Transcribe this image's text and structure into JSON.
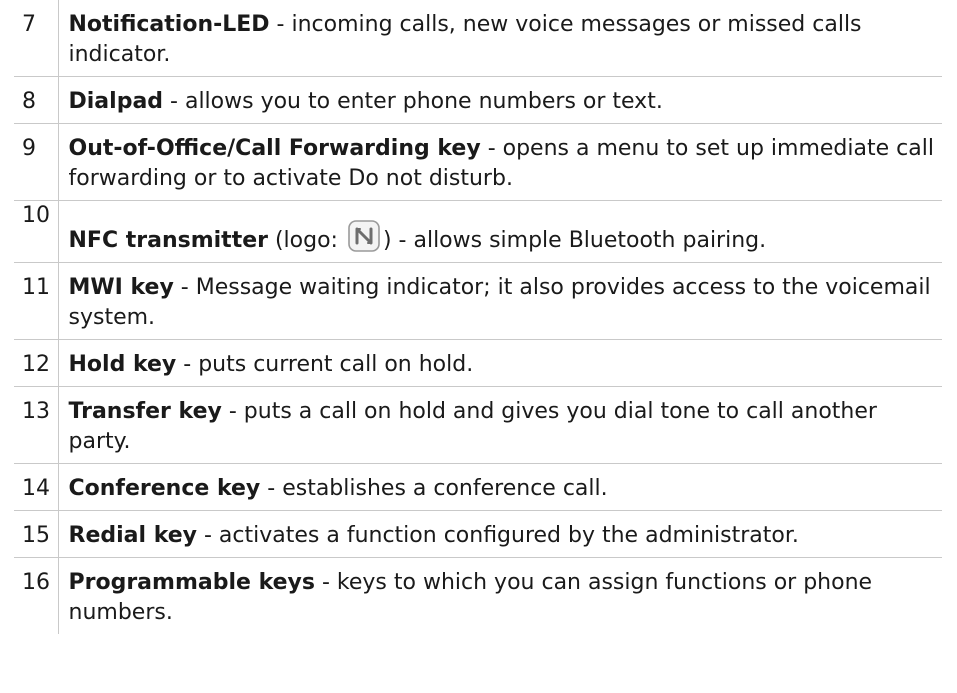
{
  "rows": [
    {
      "num": "7",
      "term": "Notification-LED",
      "desc": " - incoming calls, new voice messages or missed calls indicator."
    },
    {
      "num": "8",
      "term": "Dialpad",
      "desc": " - allows you to enter phone numbers or text."
    },
    {
      "num": "9",
      "term": "Out-of-Office/Call Forwarding key",
      "desc": " - opens a menu to set up immediate call forwarding or to activate Do not disturb."
    },
    {
      "num": "10",
      "term": "NFC transmitter",
      "desc_pre": " (logo: ",
      "desc_post": ") - allows simple Bluetooth pairing.",
      "icon": "nfc-logo-icon"
    },
    {
      "num": "11",
      "term": "MWI key",
      "desc": " - Message waiting indicator; it also provides access to the voicemail system."
    },
    {
      "num": "12",
      "term": "Hold key",
      "desc": " - puts current call on hold."
    },
    {
      "num": "13",
      "term": "Transfer key",
      "desc": " - puts a call on hold and gives you dial tone to call another party."
    },
    {
      "num": "14",
      "term": "Conference key",
      "desc": " - establishes a conference call."
    },
    {
      "num": "15",
      "term": "Redial key",
      "desc": " - activates a function configured by the administrator."
    },
    {
      "num": "16",
      "term": "Programmable keys",
      "desc": " - keys to which you can assign functions or phone numbers."
    }
  ]
}
